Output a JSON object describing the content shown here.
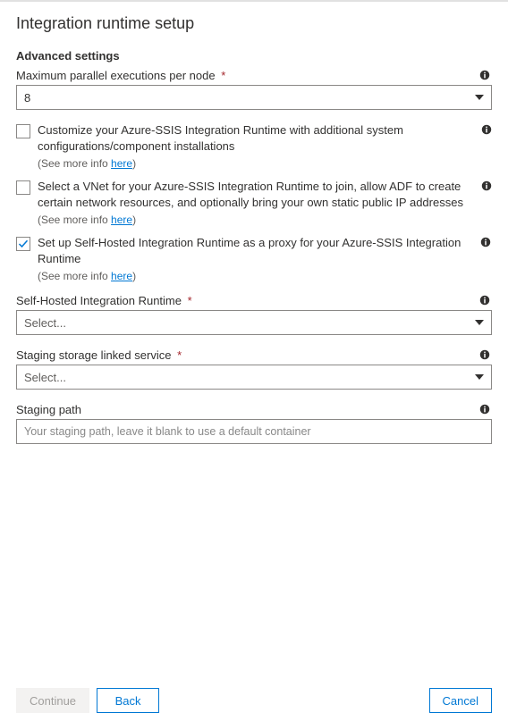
{
  "panel": {
    "title": "Integration runtime setup",
    "section": "Advanced settings"
  },
  "maxParallel": {
    "label": "Maximum parallel executions per node",
    "value": "8"
  },
  "checkboxes": {
    "customize": {
      "text": "Customize your Azure-SSIS Integration Runtime with additional system configurations/component installations",
      "checked": false
    },
    "vnet": {
      "text": "Select a VNet for your Azure-SSIS Integration Runtime to join, allow ADF to create certain network resources, and optionally bring your own static public IP addresses",
      "checked": false
    },
    "proxy": {
      "text": "Set up Self-Hosted Integration Runtime as a proxy for your Azure-SSIS Integration Runtime",
      "checked": true
    }
  },
  "moreInfo": {
    "prefix": "(See more info ",
    "link": "here",
    "suffix": ")"
  },
  "selfHostedIR": {
    "label": "Self-Hosted Integration Runtime",
    "placeholder": "Select..."
  },
  "stagingStorage": {
    "label": "Staging storage linked service",
    "placeholder": "Select..."
  },
  "stagingPath": {
    "label": "Staging path",
    "placeholder": "Your staging path, leave it blank to use a default container"
  },
  "buttons": {
    "continue": "Continue",
    "back": "Back",
    "cancel": "Cancel"
  }
}
